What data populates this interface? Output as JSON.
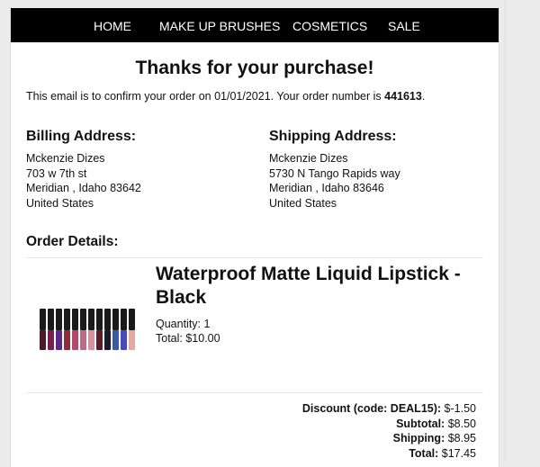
{
  "nav": {
    "items": [
      "HOME",
      "MAKE UP BRUSHES",
      "COSMETICS",
      "SALE"
    ]
  },
  "heading": "Thanks for your purchase!",
  "confirmation": {
    "text_before": "This email is to confirm your order on 01/01/2021. Your order number is ",
    "order_number": "441613",
    "text_after": "."
  },
  "billing": {
    "title": "Billing Address:",
    "lines": [
      "Mckenzie Dizes",
      "703 w 7th st",
      "Meridian , Idaho 83642",
      "United States"
    ]
  },
  "shipping": {
    "title": "Shipping Address:",
    "lines": [
      "Mckenzie Dizes",
      "5730 N Tango Rapids way",
      "Meridian , Idaho 83646",
      "United States"
    ]
  },
  "order": {
    "title": "Order Details:",
    "product": {
      "name": "Waterproof Matte Liquid Lipstick - Black",
      "quantity": "Quantity: 1",
      "total": "Total: $10.00",
      "image": "lipstick-tubes-image",
      "tube_colors": [
        "#4a1a2a",
        "#7a1f4e",
        "#5a2a8a",
        "#8a2f3a",
        "#b04a6a",
        "#c06a8a",
        "#d890a0",
        "#5a1a2a",
        "#1a1a2a",
        "#3a5aaa",
        "#4a4aba",
        "#e6a8a0"
      ]
    },
    "totals": {
      "discount_label": "Discount (code: DEAL15):",
      "discount_value": "$-1.50",
      "subtotal_label": "Subtotal:",
      "subtotal_value": "$8.50",
      "shipping_label": "Shipping:",
      "shipping_value": "$8.95",
      "total_label": "Total:",
      "total_value": "$17.45"
    }
  }
}
